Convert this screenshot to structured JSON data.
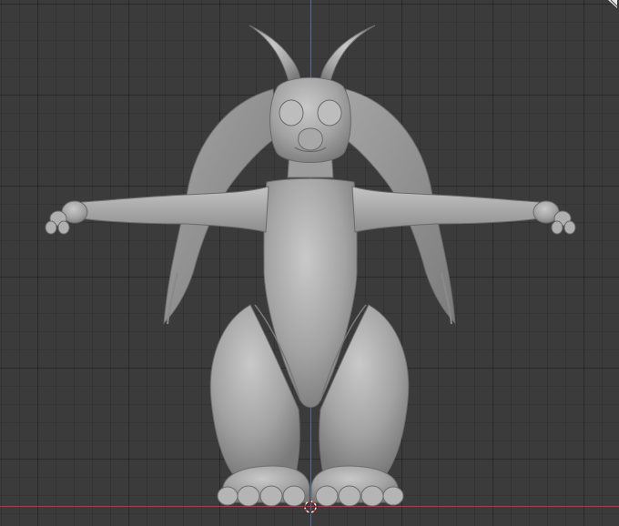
{
  "viewport": {
    "background": "#3b3b3b",
    "grid_color": "#2e2e2e",
    "axis_z_color": "#4f7fb8",
    "axis_x_color": "#a8444c",
    "model_color": "#a9a9a9"
  },
  "icons": {
    "cursor": "3d-cursor-icon",
    "corner": "area-split-corner-icon"
  }
}
